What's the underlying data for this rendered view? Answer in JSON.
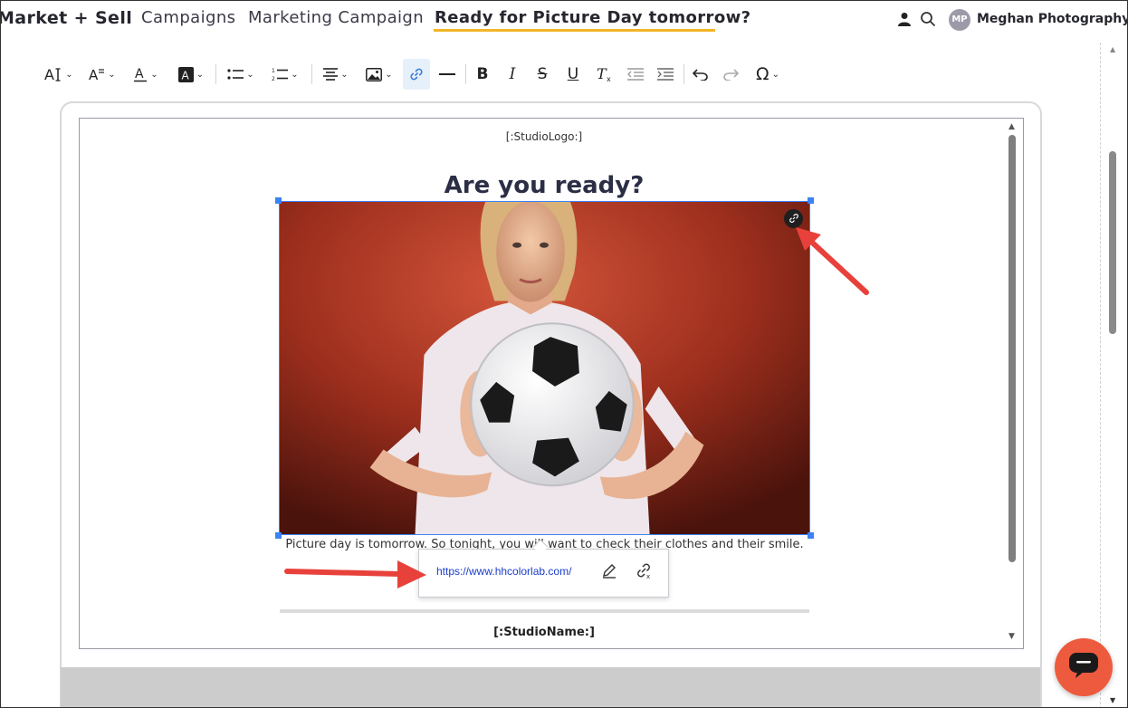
{
  "nav": {
    "breadcrumbs": [
      "Market + Sell",
      "Campaigns",
      "Marketing Campaign",
      "Ready for Picture Day tomorrow?"
    ],
    "avatar_initials": "MP",
    "account_name": "Meghan Photography",
    "active_underline_color": "#f3b526"
  },
  "toolbar": {
    "items": [
      "font-size-icon",
      "font-style-icon",
      "text-color-icon",
      "background-color-icon",
      "bulleted-list-icon",
      "numbered-list-icon",
      "align-icon",
      "image-icon",
      "link-icon",
      "horizontal-line-icon",
      "bold-icon",
      "italic-icon",
      "strikethrough-icon",
      "underline-icon",
      "clear-format-icon",
      "outdent-icon",
      "indent-icon",
      "undo-icon",
      "redo-icon",
      "special-characters-icon"
    ],
    "active_item": "link-icon"
  },
  "email": {
    "logo_placeholder": "[:StudioLogo:]",
    "headline": "Are you ready?",
    "body_text": "Picture day is tomorrow. So tonight, you will want to check their clothes and their smile. We will be there to ... e. Until then...",
    "studio_name_placeholder": "[:StudioName:]"
  },
  "link_balloon": {
    "url": "https://www.hhcolorlab.com/",
    "edit_icon": "pencil-icon",
    "unlink_icon": "unlink-icon"
  },
  "colors": {
    "accent": "#3b82f6",
    "chat_button": "#ee5a3d",
    "annotation_arrow": "#e8413b",
    "link_text": "#1a3ec9"
  }
}
